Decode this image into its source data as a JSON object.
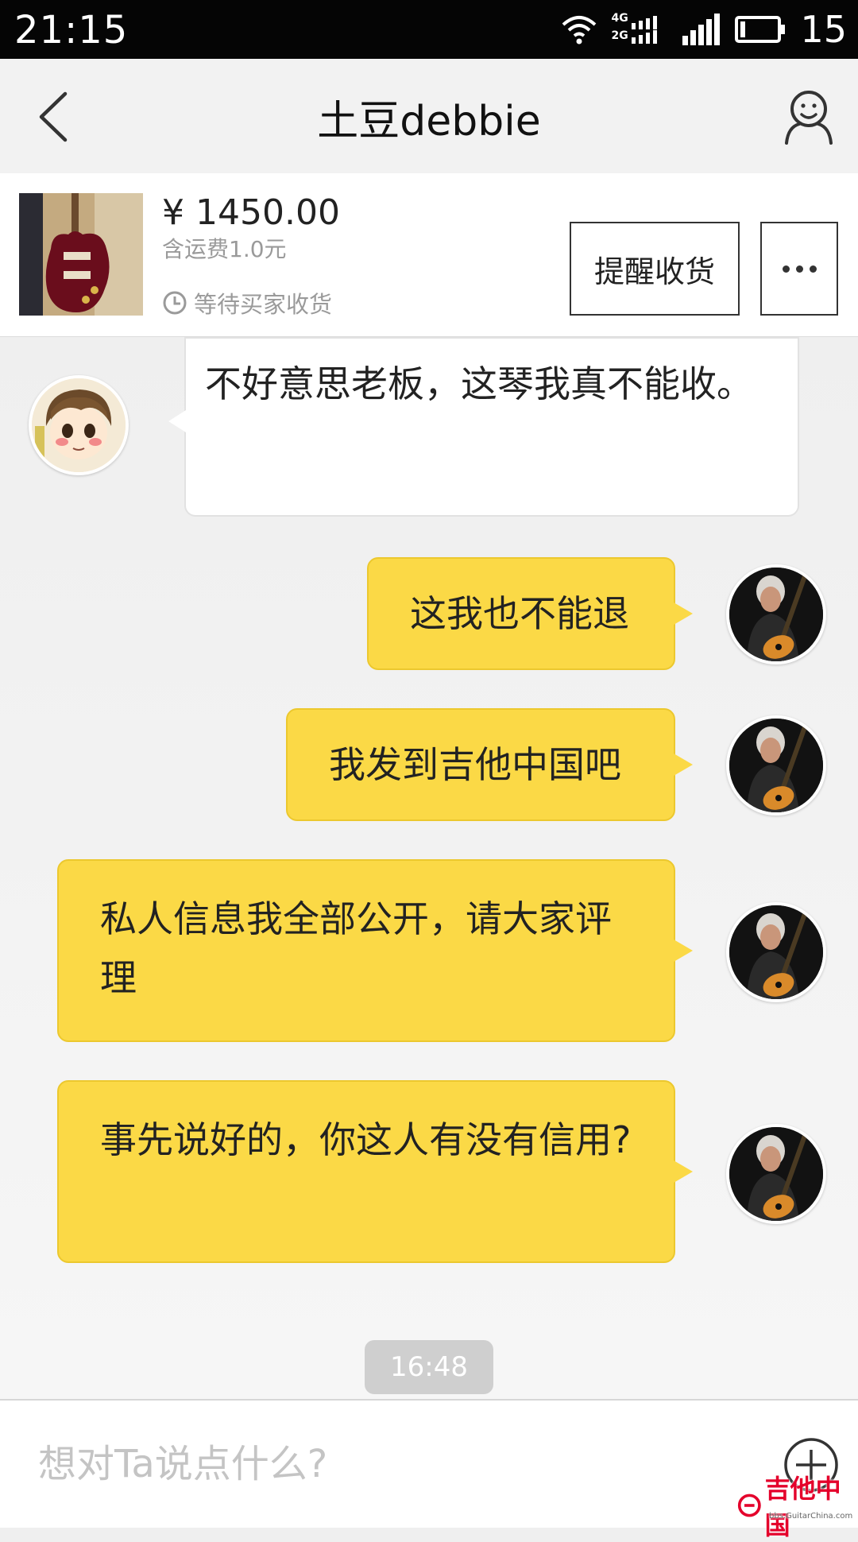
{
  "status_bar": {
    "time": "21:15",
    "network_top": "4G",
    "network_bottom": "2G",
    "battery": "15"
  },
  "header": {
    "title": "土豆debbie",
    "back_icon": "chevron-left-icon",
    "profile_icon": "user-icon"
  },
  "product": {
    "price": "¥ 1450.00",
    "shipping": "含运费1.0元",
    "status": "等待买家收货",
    "remind_button": "提醒收货"
  },
  "messages": [
    {
      "side": "left",
      "text": "不好意思老板，这琴我真不能收。"
    },
    {
      "side": "right",
      "text": "这我也不能退"
    },
    {
      "side": "right",
      "text": "我发到吉他中国吧"
    },
    {
      "side": "right",
      "text": "私人信息我全部公开，请大家评理"
    },
    {
      "side": "right",
      "text": "事先说好的，你这人有没有信用?"
    }
  ],
  "timestamp": "16:48",
  "input": {
    "placeholder": "想对Ta说点什么?"
  },
  "watermark": {
    "text": "吉他中国",
    "url": "bbs.GuitarChina.com"
  },
  "colors": {
    "bubble_self": "#fbd946",
    "status_bar": "#050505"
  }
}
